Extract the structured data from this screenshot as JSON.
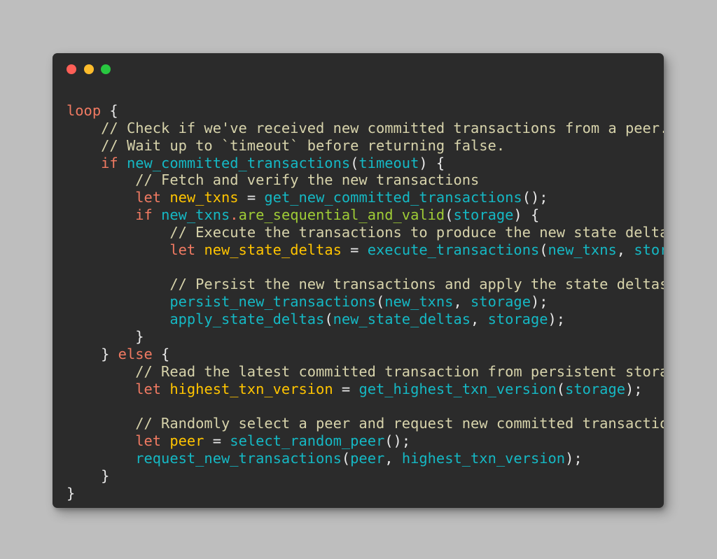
{
  "window": {
    "name": "code-snippet-window",
    "background_color": "#2b2b2b",
    "page_background_color": "#bebebe",
    "traffic_lights": [
      {
        "name": "close-button",
        "label": "close",
        "color": "#ff5f57"
      },
      {
        "name": "minimize-button",
        "label": "minimize",
        "color": "#fdbc2c"
      },
      {
        "name": "maximize-button",
        "label": "maximize",
        "color": "#28c840"
      }
    ]
  },
  "theme": {
    "keyword": "#f07a62",
    "function": "#15b8c4",
    "variable": "#ffc400",
    "method": "#9fcc36",
    "comment": "#d7d3ab",
    "punctuation": "#e8e8e8"
  },
  "code": {
    "language": "rust",
    "plain_text": "loop {\n    // Check if we've received new committed transactions from a peer.\n    // Wait up to `timeout` before returning false.\n    if new_committed_transactions(timeout) {\n        // Fetch and verify the new transactions\n        let new_txns = get_new_committed_transactions();\n        if new_txns.are_sequential_and_valid(storage) {\n            // Execute the transactions to produce the new state deltas\n            let new_state_deltas = execute_transactions(new_txns, storage);\n\n            // Persist the new transactions and apply the state deltas\n            persist_new_transactions(new_txns, storage);\n            apply_state_deltas(new_state_deltas, storage);\n        }\n    } else {\n        // Read the latest committed transaction from persistent storage\n        let highest_txn_version = get_highest_txn_version(storage);\n\n        // Randomly select a peer and request new committed transactions\n        let peer = select_random_peer();\n        request_new_transactions(peer, highest_txn_version);\n    }\n}",
    "lines": [
      {
        "n": 1,
        "tokens": [
          {
            "t": "loop",
            "c": "kw"
          },
          {
            "t": " ",
            "c": "pun"
          },
          {
            "t": "{",
            "c": "pun"
          }
        ]
      },
      {
        "n": 2,
        "tokens": [
          {
            "t": "    ",
            "c": "pun"
          },
          {
            "t": "// Check if we've received new committed transactions from a peer.",
            "c": "com"
          }
        ]
      },
      {
        "n": 3,
        "tokens": [
          {
            "t": "    ",
            "c": "pun"
          },
          {
            "t": "// Wait up to `timeout` before returning false.",
            "c": "com"
          }
        ]
      },
      {
        "n": 4,
        "tokens": [
          {
            "t": "    ",
            "c": "pun"
          },
          {
            "t": "if",
            "c": "kw"
          },
          {
            "t": " ",
            "c": "pun"
          },
          {
            "t": "new_committed_transactions",
            "c": "fn"
          },
          {
            "t": "(",
            "c": "pun"
          },
          {
            "t": "timeout",
            "c": "fn"
          },
          {
            "t": ") {",
            "c": "pun"
          }
        ]
      },
      {
        "n": 5,
        "tokens": [
          {
            "t": "        ",
            "c": "pun"
          },
          {
            "t": "// Fetch and verify the new transactions",
            "c": "com"
          }
        ]
      },
      {
        "n": 6,
        "tokens": [
          {
            "t": "        ",
            "c": "pun"
          },
          {
            "t": "let",
            "c": "kw"
          },
          {
            "t": " ",
            "c": "pun"
          },
          {
            "t": "new_txns",
            "c": "var"
          },
          {
            "t": " = ",
            "c": "pun"
          },
          {
            "t": "get_new_committed_transactions",
            "c": "fn"
          },
          {
            "t": "();",
            "c": "pun"
          }
        ]
      },
      {
        "n": 7,
        "tokens": [
          {
            "t": "        ",
            "c": "pun"
          },
          {
            "t": "if",
            "c": "kw"
          },
          {
            "t": " ",
            "c": "pun"
          },
          {
            "t": "new_txns",
            "c": "fn"
          },
          {
            "t": ".",
            "c": "kw"
          },
          {
            "t": "are_sequential_and_valid",
            "c": "meth"
          },
          {
            "t": "(",
            "c": "pun"
          },
          {
            "t": "storage",
            "c": "fn"
          },
          {
            "t": ") {",
            "c": "pun"
          }
        ]
      },
      {
        "n": 8,
        "tokens": [
          {
            "t": "            ",
            "c": "pun"
          },
          {
            "t": "// Execute the transactions to produce the new state deltas",
            "c": "com"
          }
        ]
      },
      {
        "n": 9,
        "tokens": [
          {
            "t": "            ",
            "c": "pun"
          },
          {
            "t": "let",
            "c": "kw"
          },
          {
            "t": " ",
            "c": "pun"
          },
          {
            "t": "new_state_deltas",
            "c": "var"
          },
          {
            "t": " = ",
            "c": "pun"
          },
          {
            "t": "execute_transactions",
            "c": "fn"
          },
          {
            "t": "(",
            "c": "pun"
          },
          {
            "t": "new_txns",
            "c": "fn"
          },
          {
            "t": ", ",
            "c": "pun"
          },
          {
            "t": "storage",
            "c": "fn"
          },
          {
            "t": ");",
            "c": "pun"
          }
        ]
      },
      {
        "n": 10,
        "tokens": []
      },
      {
        "n": 11,
        "tokens": [
          {
            "t": "            ",
            "c": "pun"
          },
          {
            "t": "// Persist the new transactions and apply the state deltas",
            "c": "com"
          }
        ]
      },
      {
        "n": 12,
        "tokens": [
          {
            "t": "            ",
            "c": "pun"
          },
          {
            "t": "persist_new_transactions",
            "c": "fn"
          },
          {
            "t": "(",
            "c": "pun"
          },
          {
            "t": "new_txns",
            "c": "fn"
          },
          {
            "t": ", ",
            "c": "pun"
          },
          {
            "t": "storage",
            "c": "fn"
          },
          {
            "t": ");",
            "c": "pun"
          }
        ]
      },
      {
        "n": 13,
        "tokens": [
          {
            "t": "            ",
            "c": "pun"
          },
          {
            "t": "apply_state_deltas",
            "c": "fn"
          },
          {
            "t": "(",
            "c": "pun"
          },
          {
            "t": "new_state_deltas",
            "c": "fn"
          },
          {
            "t": ", ",
            "c": "pun"
          },
          {
            "t": "storage",
            "c": "fn"
          },
          {
            "t": ");",
            "c": "pun"
          }
        ]
      },
      {
        "n": 14,
        "tokens": [
          {
            "t": "        }",
            "c": "pun"
          }
        ]
      },
      {
        "n": 15,
        "tokens": [
          {
            "t": "    } ",
            "c": "pun"
          },
          {
            "t": "else",
            "c": "kw"
          },
          {
            "t": " {",
            "c": "pun"
          }
        ]
      },
      {
        "n": 16,
        "tokens": [
          {
            "t": "        ",
            "c": "pun"
          },
          {
            "t": "// Read the latest committed transaction from persistent storage",
            "c": "com"
          }
        ]
      },
      {
        "n": 17,
        "tokens": [
          {
            "t": "        ",
            "c": "pun"
          },
          {
            "t": "let",
            "c": "kw"
          },
          {
            "t": " ",
            "c": "pun"
          },
          {
            "t": "highest_txn_version",
            "c": "var"
          },
          {
            "t": " = ",
            "c": "pun"
          },
          {
            "t": "get_highest_txn_version",
            "c": "fn"
          },
          {
            "t": "(",
            "c": "pun"
          },
          {
            "t": "storage",
            "c": "fn"
          },
          {
            "t": ");",
            "c": "pun"
          }
        ]
      },
      {
        "n": 18,
        "tokens": []
      },
      {
        "n": 19,
        "tokens": [
          {
            "t": "        ",
            "c": "pun"
          },
          {
            "t": "// Randomly select a peer and request new committed transactions",
            "c": "com"
          }
        ]
      },
      {
        "n": 20,
        "tokens": [
          {
            "t": "        ",
            "c": "pun"
          },
          {
            "t": "let",
            "c": "kw"
          },
          {
            "t": " ",
            "c": "pun"
          },
          {
            "t": "peer",
            "c": "var"
          },
          {
            "t": " = ",
            "c": "pun"
          },
          {
            "t": "select_random_peer",
            "c": "fn"
          },
          {
            "t": "();",
            "c": "pun"
          }
        ]
      },
      {
        "n": 21,
        "tokens": [
          {
            "t": "        ",
            "c": "pun"
          },
          {
            "t": "request_new_transactions",
            "c": "fn"
          },
          {
            "t": "(",
            "c": "pun"
          },
          {
            "t": "peer",
            "c": "fn"
          },
          {
            "t": ", ",
            "c": "pun"
          },
          {
            "t": "highest_txn_version",
            "c": "fn"
          },
          {
            "t": ");",
            "c": "pun"
          }
        ]
      },
      {
        "n": 22,
        "tokens": [
          {
            "t": "    }",
            "c": "pun"
          }
        ]
      },
      {
        "n": 23,
        "tokens": [
          {
            "t": "}",
            "c": "pun"
          }
        ]
      }
    ]
  }
}
